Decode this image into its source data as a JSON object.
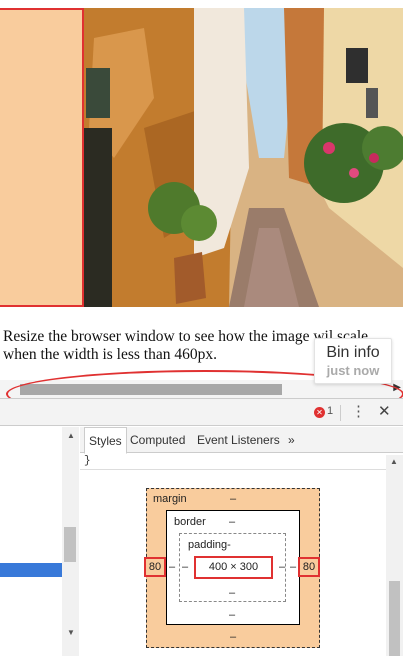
{
  "preview": {
    "caption": "Resize the browser window to see how the image wil scale when the width is less than 460px.",
    "bin_info": {
      "title": "Bin info",
      "subtitle": "just now"
    },
    "scroll_right_arrow": "▶"
  },
  "devtools": {
    "error_count": "1",
    "error_badge": "✕",
    "menu_icon": "⋮",
    "close_icon": "✕",
    "dom_scroll_up": "▲",
    "dom_scroll_down": "▼",
    "styles_scroll_up": "▲",
    "tabs": {
      "styles": "Styles",
      "computed": "Computed",
      "event_listeners": "Event Listeners",
      "more": "»"
    },
    "brace": "}",
    "box_model": {
      "margin_label": "margin",
      "margin_top": "–",
      "margin_bottom": "–",
      "margin_left": "80",
      "margin_right": "80",
      "border_label": "border",
      "border_top": "–",
      "border_bottom": "–",
      "border_left": "–",
      "border_right": "–",
      "padding_label": "padding-",
      "padding_bottom": "–",
      "padding_left": "–",
      "padding_right": "–",
      "content": "400 × 300"
    }
  },
  "colors": {
    "margin_fill": "#f9cc9d",
    "annotation_red": "#e03131",
    "selection_blue": "#3879d9"
  }
}
